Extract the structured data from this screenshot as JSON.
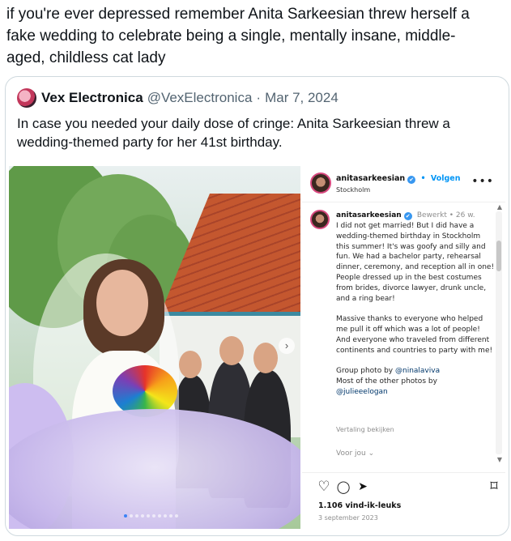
{
  "post": {
    "text": "if you're ever depressed remember Anita Sarkeesian threw herself a fake wedding to celebrate being a single, mentally insane, middle-aged, childless cat lady"
  },
  "quoted": {
    "display_name": "Vex Electronica",
    "handle": "@VexElectronica",
    "separator": "·",
    "date": "Mar 7, 2024",
    "text": "In case you needed your daily dose of cringe: Anita Sarkeesian threw a wedding-themed party for her 41st birthday."
  },
  "instagram": {
    "username": "anitasarkeesian",
    "verified_icon": "✔",
    "follow_sep": "•",
    "follow_label": "Volgen",
    "location": "Stockholm",
    "more_icon": "•••",
    "caption_user": "anitasarkeesian",
    "caption_meta": "Bewerkt  •  26 w.",
    "caption_p1": "I did not get married! But I did have a wedding-themed birthday in Stockholm this summer! It's was goofy and silly and fun. We had a bachelor party, rehearsal dinner, ceremony, and reception all in one! People dressed up in the best costumes from brides, divorce lawyer, drunk uncle, and a ring bear!",
    "caption_p2": "Massive thanks to everyone who helped me pull it off which was a lot of people! And everyone who traveled from different continents and countries to party with me!",
    "caption_p3_prefix": "Group photo by ",
    "caption_p3_link1": "@ninalaviva",
    "caption_p3_mid": "Most of the other photos by",
    "caption_p3_link2": "@julieeelogan",
    "translation_label": "Vertaling bekijken",
    "see_translation": "Voor jou ⌄",
    "likes": "1.106 vind-ik-leuks",
    "post_date": "3 september 2023"
  },
  "icons": {
    "heart": "♡",
    "comment": "◯",
    "share": "➤",
    "save": "⌑",
    "next": "›"
  }
}
